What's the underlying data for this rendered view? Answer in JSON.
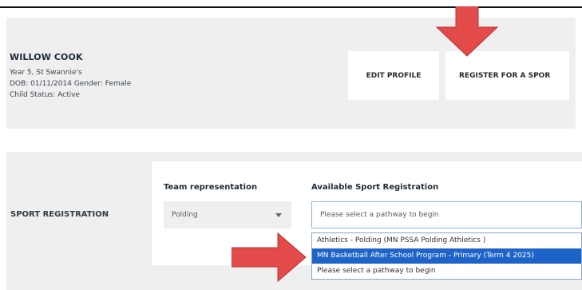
{
  "profile": {
    "name": "WILLOW COOK",
    "school_line": "Year 5, St Swannie's",
    "dob_gender_line": "DOB: 01/11/2014 Gender: Female",
    "status_line": "Child Status: Active",
    "edit_button": "EDIT PROFILE",
    "register_button": "REGISTER FOR A SPOR"
  },
  "registration": {
    "section_label": "SPORT REGISTRATION",
    "team_heading": "Team representation",
    "team_value": "Polding",
    "available_heading": "Available Sport Registration",
    "pathway_placeholder": "Please select a pathway to begin",
    "options": [
      "Athletics - Polding (MN PSSA Polding Athletics )",
      "MN Basketball After School Program - Primary (Term 4 2025)",
      "Please select a pathway to begin"
    ],
    "selected_index": 1
  },
  "annotations": {
    "arrow_color": "#e34a4a",
    "arrow_icon": "red-arrow-icon"
  }
}
